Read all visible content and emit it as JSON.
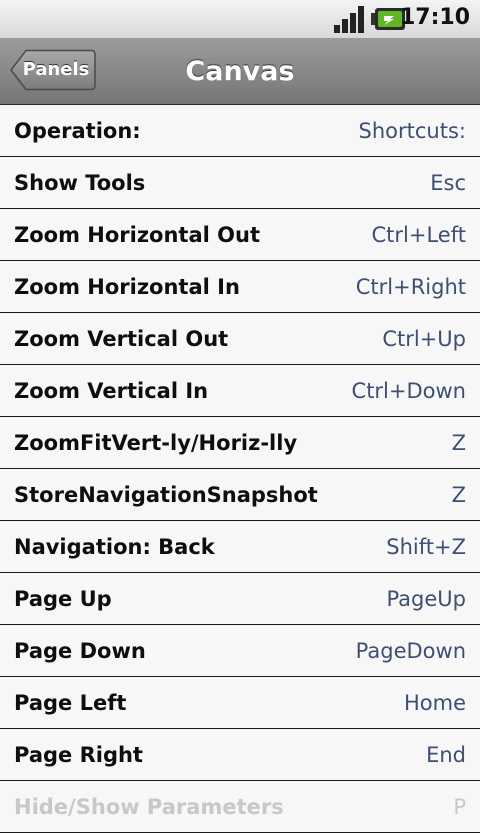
{
  "status_bar": {
    "time": "17:10",
    "icons": [
      "signal-icon",
      "battery-icon"
    ]
  },
  "title_bar": {
    "back_label": "Panels",
    "title": "Canvas"
  },
  "header_row": {
    "label": "Operation:",
    "key": "Shortcuts:"
  },
  "rows": [
    {
      "label": "Show Tools",
      "key": "Esc"
    },
    {
      "label": "Zoom Horizontal Out",
      "key": "Ctrl+Left"
    },
    {
      "label": "Zoom Horizontal In",
      "key": "Ctrl+Right"
    },
    {
      "label": "Zoom Vertical Out",
      "key": "Ctrl+Up"
    },
    {
      "label": "Zoom Vertical In",
      "key": "Ctrl+Down"
    },
    {
      "label": "ZoomFitVert-ly/Horiz-lly",
      "key": "Z"
    },
    {
      "label": "StoreNavigationSnapshot",
      "key": "Z"
    },
    {
      "label": "Navigation: Back",
      "key": "Shift+Z"
    },
    {
      "label": "Page Up",
      "key": "PageUp"
    },
    {
      "label": "Page Down",
      "key": "PageDown"
    },
    {
      "label": "Page Left",
      "key": "Home"
    },
    {
      "label": "Page Right",
      "key": "End"
    },
    {
      "label": "Hide/Show Parameters",
      "key": "P"
    }
  ],
  "colors": {
    "label_text": "#0e0e0e",
    "shortcut_text": "#3d4f75",
    "divider": "#1a1a1a",
    "title_bar": "#8a8a8a",
    "battery_accent": "#5fb820"
  }
}
